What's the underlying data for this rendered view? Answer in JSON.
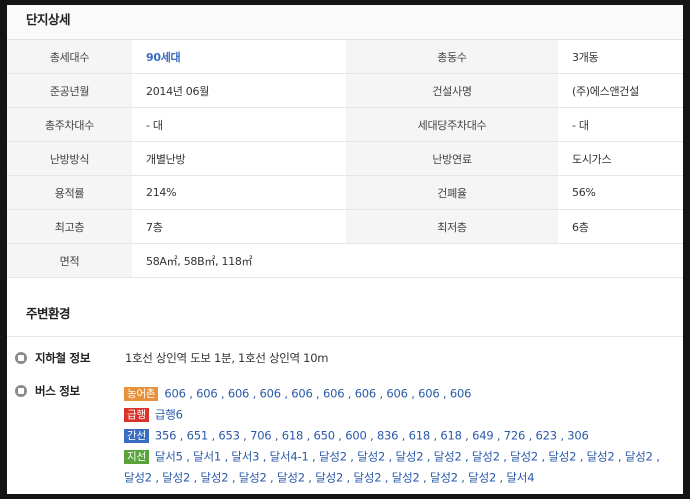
{
  "detail": {
    "title": "단지상세",
    "rows": [
      {
        "k1": "총세대수",
        "v1": "90세대",
        "k2": "총동수",
        "v2": "3개동"
      },
      {
        "k1": "준공년월",
        "v1": "2014년 06월",
        "k2": "건설사명",
        "v2": "(주)에스앤건설"
      },
      {
        "k1": "총주차대수",
        "v1": "- 대",
        "k2": "세대당주차대수",
        "v2": "- 대"
      },
      {
        "k1": "난방방식",
        "v1": "개별난방",
        "k2": "난방연료",
        "v2": "도시가스"
      },
      {
        "k1": "용적률",
        "v1": "214%",
        "k2": "건폐율",
        "v2": "56%"
      },
      {
        "k1": "최고층",
        "v1": "7층",
        "k2": "최저층",
        "v2": "6층"
      },
      {
        "k1": "면적",
        "v1": "58A㎡, 58B㎡, 118㎡"
      }
    ]
  },
  "env": {
    "title": "주변환경",
    "subway": {
      "label": "지하철 정보",
      "value": "1호선 상인역 도보 1분, 1호선 상인역 10m"
    },
    "bus": {
      "label": "버스 정보",
      "lines": [
        {
          "tag": "농어촌",
          "color": "#e8913a",
          "stops": "606 , 606 , 606 , 606 , 606 , 606 , 606 , 606 , 606 , 606"
        },
        {
          "tag": "급행",
          "color": "#d9322b",
          "stops": "급행6"
        },
        {
          "tag": "간선",
          "color": "#3a6cc1",
          "stops": "356 , 651 , 653 , 706 , 618 , 650 , 600 , 836 , 618 , 618 , 649 , 726 , 623 , 306"
        },
        {
          "tag": "지선",
          "color": "#5aa33a",
          "stops": "달서5 , 달서1 , 달서3 , 달서4-1 , 달성2 , 달성2 , 달성2 , 달성2 , 달성2 , 달성2 , 달성2 , 달성2 , 달성2 , 달성2 , 달성2 , 달성2 , 달성2 , 달성2 , 달성2 , 달성2 , 달성2 , 달성2 , 달성2 , 달서4"
        }
      ]
    }
  }
}
